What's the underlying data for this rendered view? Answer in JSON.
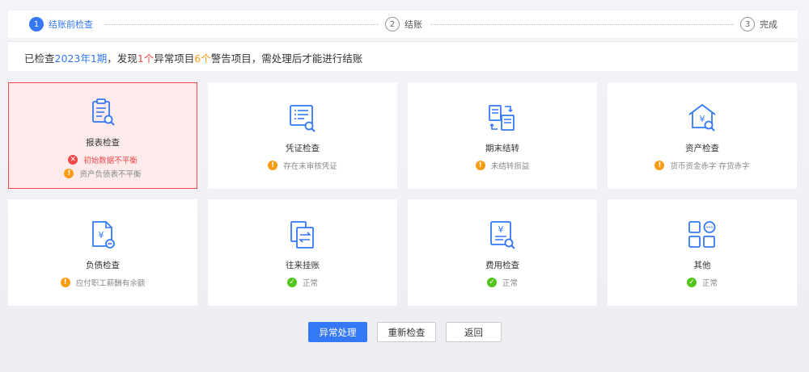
{
  "steps": [
    {
      "num": "1",
      "label": "结账前检查"
    },
    {
      "num": "2",
      "label": "结账"
    },
    {
      "num": "3",
      "label": "完成"
    }
  ],
  "summary": {
    "p1": "已检查",
    "period": "2023年1期",
    "p2": "，发现",
    "abnormal": "1个",
    "p3": "异常项目",
    "warning": "6个",
    "p4": "警告项目，需处理后才能进行结账"
  },
  "cards": [
    {
      "title": "报表检查",
      "icon": "clipboard-search-icon",
      "status": [
        {
          "type": "error",
          "text": "初始数据不平衡"
        },
        {
          "type": "warning",
          "text": "资产负债表不平衡"
        }
      ]
    },
    {
      "title": "凭证检查",
      "icon": "voucher-search-icon",
      "status": [
        {
          "type": "warning",
          "text": "存在未审核凭证"
        }
      ]
    },
    {
      "title": "期末结转",
      "icon": "transfer-icon",
      "status": [
        {
          "type": "warning",
          "text": "未结转损益"
        }
      ]
    },
    {
      "title": "资产检查",
      "icon": "asset-house-icon",
      "status": [
        {
          "type": "warning",
          "text": "货币资金赤字 存货赤字"
        }
      ]
    },
    {
      "title": "负债检查",
      "icon": "liability-doc-icon",
      "status": [
        {
          "type": "warning",
          "text": "应付职工薪酬有余额"
        }
      ]
    },
    {
      "title": "往来挂账",
      "icon": "exchange-doc-icon",
      "status": [
        {
          "type": "ok",
          "text": "正常"
        }
      ]
    },
    {
      "title": "费用检查",
      "icon": "expense-search-icon",
      "status": [
        {
          "type": "ok",
          "text": "正常"
        }
      ]
    },
    {
      "title": "其他",
      "icon": "grid-apps-icon",
      "status": [
        {
          "type": "ok",
          "text": "正常"
        }
      ]
    }
  ],
  "buttons": {
    "handle": "异常处理",
    "recheck": "重新检查",
    "back": "返回"
  },
  "colors": {
    "primary": "#3478f6",
    "error": "#f04848",
    "warning": "#fa9b14",
    "ok": "#52c41a"
  }
}
